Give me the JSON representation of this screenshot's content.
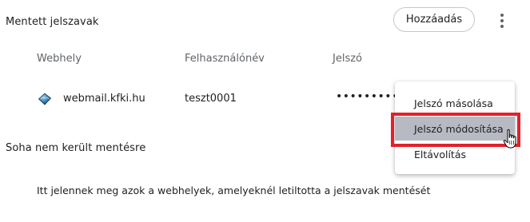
{
  "saved_passwords": {
    "title": "Mentett jelszavak",
    "add_button_label": "Hozzáadás",
    "more_icon": "more-vert-icon",
    "columns": {
      "site": "Webhely",
      "username": "Felhasználónév",
      "password": "Jelszó"
    },
    "rows": [
      {
        "site_icon": "globe-favicon-icon",
        "site": "webmail.kfki.hu",
        "username": "teszt0001",
        "password_masked": "••••••••••"
      }
    ]
  },
  "never_saved": {
    "title": "Soha nem került mentésre",
    "description": "Itt jelennek meg azok a webhelyek, amelyeknél letiltotta a jelszavak mentését"
  },
  "context_menu": {
    "items": [
      {
        "label": "Jelszó másolása",
        "state": "normal"
      },
      {
        "label": "Jelszó módosítása",
        "state": "hovered"
      },
      {
        "label": "Eltávolítás",
        "state": "normal"
      }
    ]
  },
  "annotation": {
    "highlight_color": "#e3202b",
    "cursor_icon": "hand-pointer-icon"
  },
  "colors": {
    "hover_background": "#b8bac3",
    "secondary_text": "#5f6368",
    "border": "#c7c7c7"
  }
}
